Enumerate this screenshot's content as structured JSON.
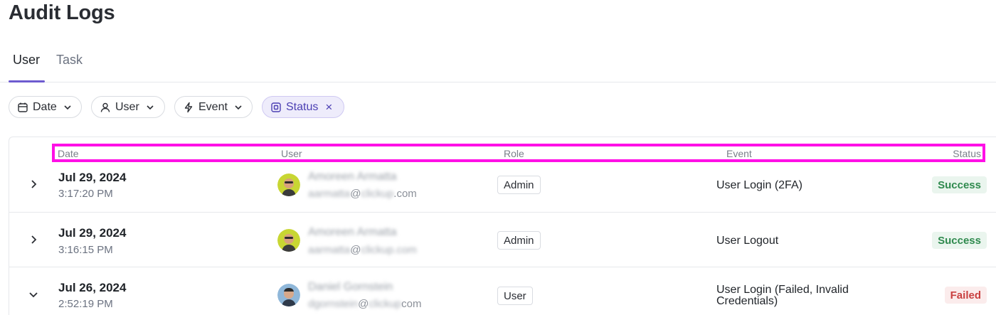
{
  "page": {
    "title": "Audit Logs"
  },
  "tabs": [
    {
      "label": "User",
      "active": true
    },
    {
      "label": "Task",
      "active": false
    }
  ],
  "filters": {
    "date": {
      "label": "Date",
      "icon": "calendar-icon"
    },
    "user": {
      "label": "User",
      "icon": "person-icon"
    },
    "event": {
      "label": "Event",
      "icon": "lightning-icon"
    },
    "status": {
      "label": "Status",
      "icon": "status-square-icon",
      "remove": "×",
      "active": true
    }
  },
  "table": {
    "headers": {
      "date": "Date",
      "user": "User",
      "role": "Role",
      "event": "Event",
      "status": "Status"
    },
    "rows": [
      {
        "expanded": false,
        "date": "Jul 29, 2024",
        "time": "3:17:20 PM",
        "user_name": "Amoreen Armatta",
        "email_local": "aarmatta",
        "email_at": "@",
        "email_domain": "clickup",
        "email_tld": ".com",
        "role": "Admin",
        "event": "User Login (2FA)",
        "status": "Success"
      },
      {
        "expanded": false,
        "date": "Jul 29, 2024",
        "time": "3:16:15 PM",
        "user_name": "Amoreen Armatta",
        "email_local": "aarmatta",
        "email_at": "@",
        "email_domain": "clickup.com",
        "email_tld": "",
        "role": "Admin",
        "event": "User Logout",
        "status": "Success"
      },
      {
        "expanded": true,
        "date": "Jul 26, 2024",
        "time": "2:52:19 PM",
        "user_name": "Daniel Gornstein",
        "email_local": "dgornstein",
        "email_at": "@",
        "email_domain": "clickup",
        "email_tld": "com",
        "role": "User",
        "event": "User Login (Failed, Invalid Credentials)",
        "status": "Failed"
      }
    ]
  },
  "colors": {
    "accent": "#6d5bd0",
    "highlight_box": "#ff10e6",
    "success": "#2f8a4e",
    "failed": "#c94040"
  }
}
